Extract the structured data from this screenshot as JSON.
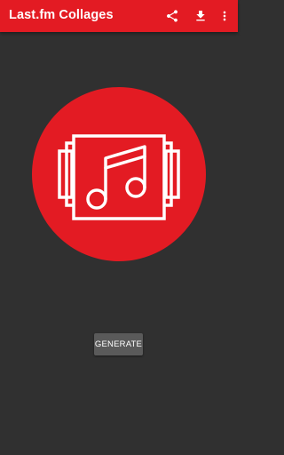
{
  "app_bar": {
    "title": "Last.fm Collages",
    "background_color": "#e31b23",
    "actions": [
      {
        "icon": "share-icon"
      },
      {
        "icon": "download-icon"
      },
      {
        "icon": "more-vert-icon"
      }
    ]
  },
  "main": {
    "logo": {
      "icon": "music-collage-logo",
      "circle_color": "#e31b23"
    },
    "generate_label": "GENERATE",
    "background_color": "#303030"
  }
}
